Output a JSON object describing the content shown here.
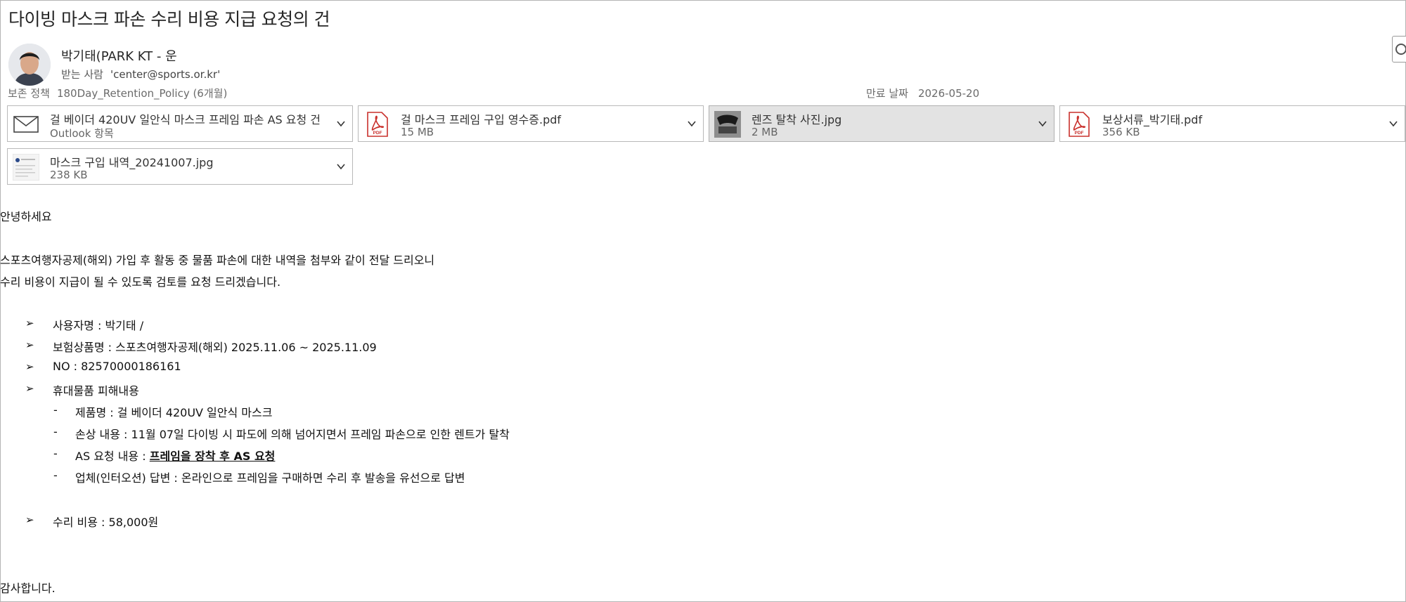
{
  "email": {
    "subject": "다이빙 마스크 파손 수리 비용 지급 요청의 건",
    "sender": "박기태(PARK KT - 운",
    "to_label": "받는 사람",
    "to_value": "'center@sports.or.kr'",
    "retention_label": "보존 정책",
    "retention_value": "180Day_Retention_Policy (6개월)",
    "expiry_label": "만료 날짜",
    "expiry_value": "2026-05-20"
  },
  "attachments": [
    {
      "name": "걸 베이더 420UV  일안식 마스크 프레임 파손 AS 요청 건",
      "size": "Outlook 항목",
      "icon": "mail-icon"
    },
    {
      "name": "걸 마스크 프레임 구입 영수증.pdf",
      "size": "15 MB",
      "icon": "pdf-icon"
    },
    {
      "name": "렌즈 탈착 사진.jpg",
      "size": "2 MB",
      "icon": "image-thumbnail"
    },
    {
      "name": "보상서류_박기태.pdf",
      "size": "356 KB",
      "icon": "pdf-icon"
    },
    {
      "name": "마스크 구입 내역_20241007.jpg",
      "size": "238 KB",
      "icon": "image-thumbnail"
    }
  ],
  "body": {
    "greeting": "안녕하세요",
    "para1": "스포츠여행자공제(해외) 가입 후 활동 중 물품 파손에 대한 내역을 첨부와 같이 전달 드리오니",
    "para2": "수리 비용이 지급이 될 수 있도록 검토를 요청 드리겠습니다.",
    "bullet_glyph": "➢",
    "dash_glyph": "-",
    "user": "사용자명 : 박기태 /",
    "product": "보험상품명 : 스포츠여행자공제(해외) 2025.11.06 ~ 2025.11.09",
    "no": "NO : 82570000186161",
    "damage_title": "휴대물품 피해내용",
    "item_name": "제품명 : 걸 베이더 420UV 일안식 마스크",
    "damage_content": "손상 내용 : 11월 07일 다이빙 시 파도에 의해 넘어지면서 프레임 파손으로 인한 렌트가 탈착",
    "as_label": "AS 요청 내용 : ",
    "as_value": "프레임을 장착 후 AS 요청",
    "vendor_reply": "업체(인터오션) 답변 : 온라인으로 프레임을 구매하면 수리 후 발송을 유선으로 답변",
    "cost": "수리 비용 : 58,000원",
    "closing": "감사합니다."
  }
}
